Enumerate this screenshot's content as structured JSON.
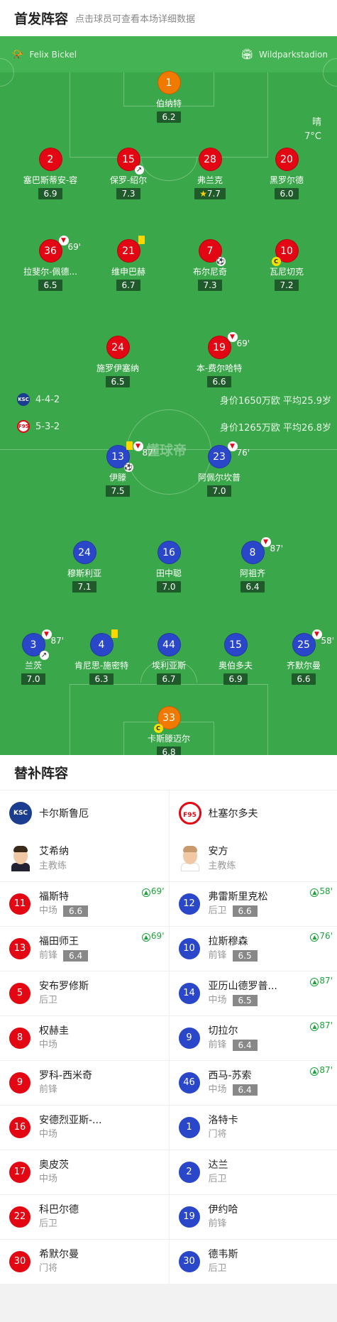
{
  "header": {
    "title": "首发阵容",
    "subtitle": "点击球员可查看本场详细数据"
  },
  "match": {
    "referee": "Felix Bickel",
    "stadium": "Wildparkstadion",
    "weather": "晴",
    "temperature": "7°C",
    "watermark": "懂球帝"
  },
  "teams": {
    "home": {
      "name": "卡尔斯鲁厄",
      "formation": "4-4-2",
      "stats": "身价1650万欧 平均25.9岁",
      "badge": "KSC"
    },
    "away": {
      "name": "杜塞尔多夫",
      "formation": "5-3-2",
      "stats": "身价1265万欧 平均26.8岁",
      "badge": "F95"
    }
  },
  "away_players": [
    {
      "num": "1",
      "name": "伯纳特",
      "rating": "6.2"
    },
    {
      "num": "2",
      "name": "塞巴斯蒂安-容",
      "rating": "6.9"
    },
    {
      "num": "15",
      "name": "保罗-绍尔",
      "rating": "7.3"
    },
    {
      "num": "28",
      "name": "弗兰克",
      "rating": "7.7"
    },
    {
      "num": "20",
      "name": "黑罗尔德",
      "rating": "6.0"
    },
    {
      "num": "36",
      "name": "拉斐尔-佩德...",
      "rating": "6.5",
      "sub_time": "69'"
    },
    {
      "num": "21",
      "name": "维申巴赫",
      "rating": "6.7"
    },
    {
      "num": "7",
      "name": "布尔尼奇",
      "rating": "7.3"
    },
    {
      "num": "10",
      "name": "瓦尼切克",
      "rating": "7.2"
    },
    {
      "num": "24",
      "name": "施罗伊塞纳",
      "rating": "6.5"
    },
    {
      "num": "19",
      "name": "本-费尔哈特",
      "rating": "6.6",
      "sub_time": "69'"
    }
  ],
  "home_players": [
    {
      "num": "13",
      "name": "伊滕",
      "rating": "7.5",
      "sub_time": "87'"
    },
    {
      "num": "23",
      "name": "阿佩尔坎普",
      "rating": "7.0",
      "sub_time": "76'"
    },
    {
      "num": "24",
      "name": "穆斯利亚",
      "rating": "7.1"
    },
    {
      "num": "16",
      "name": "田中聪",
      "rating": "7.0"
    },
    {
      "num": "8",
      "name": "阿祖齐",
      "rating": "6.4",
      "sub_time": "87'"
    },
    {
      "num": "3",
      "name": "兰茨",
      "rating": "7.0",
      "sub_time": "87'"
    },
    {
      "num": "4",
      "name": "肯尼思-施密特",
      "rating": "6.3"
    },
    {
      "num": "44",
      "name": "埃利亚斯",
      "rating": "6.7"
    },
    {
      "num": "15",
      "name": "奥伯多夫",
      "rating": "6.9"
    },
    {
      "num": "25",
      "name": "齐默尔曼",
      "rating": "6.6",
      "sub_time": "58'"
    },
    {
      "num": "33",
      "name": "卡斯滕迈尔",
      "rating": "6.8"
    }
  ],
  "subs_section": {
    "title": "替补阵容",
    "coach_role": "主教练"
  },
  "home_bench": {
    "coach": "艾希纳",
    "subs": [
      {
        "num": "11",
        "name": "福斯特",
        "pos": "中场",
        "rating": "6.6",
        "in": "69'"
      },
      {
        "num": "13",
        "name": "福田师王",
        "pos": "前锋",
        "rating": "6.4",
        "in": "69'"
      },
      {
        "num": "5",
        "name": "安布罗修斯",
        "pos": "后卫"
      },
      {
        "num": "8",
        "name": "权赫圭",
        "pos": "中场"
      },
      {
        "num": "9",
        "name": "罗科-西米奇",
        "pos": "前锋"
      },
      {
        "num": "16",
        "name": "安德烈亚斯-...",
        "pos": "中场"
      },
      {
        "num": "17",
        "name": "奥皮茨",
        "pos": "中场"
      },
      {
        "num": "22",
        "name": "科巴尔德",
        "pos": "后卫"
      },
      {
        "num": "30",
        "name": "希默尔曼",
        "pos": "门将"
      }
    ]
  },
  "away_bench": {
    "coach": "安方",
    "subs": [
      {
        "num": "12",
        "name": "弗雷斯里克松",
        "pos": "后卫",
        "rating": "6.6",
        "in": "58'"
      },
      {
        "num": "10",
        "name": "拉斯穆森",
        "pos": "前锋",
        "rating": "6.5",
        "in": "76'"
      },
      {
        "num": "14",
        "name": "亚历山德罗普...",
        "pos": "中场",
        "rating": "6.5",
        "in": "87'"
      },
      {
        "num": "9",
        "name": "切拉尔",
        "pos": "前锋",
        "rating": "6.4",
        "in": "87'"
      },
      {
        "num": "46",
        "name": "西马-苏索",
        "pos": "中场",
        "rating": "6.4",
        "in": "87'"
      },
      {
        "num": "1",
        "name": "洛特卡",
        "pos": "门将"
      },
      {
        "num": "2",
        "name": "达兰",
        "pos": "后卫"
      },
      {
        "num": "19",
        "name": "伊约哈",
        "pos": "前锋"
      },
      {
        "num": "30",
        "name": "德韦斯",
        "pos": "后卫"
      }
    ]
  }
}
